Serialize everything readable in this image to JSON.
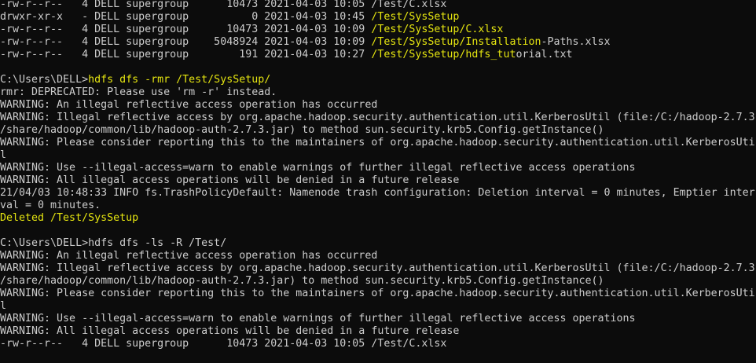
{
  "colors": {
    "background": "#0c0c0c",
    "text": "#cccccc",
    "highlight": "#e5e510"
  },
  "lines": [
    [
      {
        "t": "-rw-r--r--   4 DELL supergroup      10473 2021-04-03 10:05 ",
        "c": "w"
      },
      {
        "t": "/Test/C.xlsx",
        "c": "w"
      }
    ],
    [
      {
        "t": "drwxr-xr-x   - DELL supergroup          0 2021-04-03 10:45 ",
        "c": "w"
      },
      {
        "t": "/Test/SysSetup",
        "c": "y"
      }
    ],
    [
      {
        "t": "-rw-r--r--   4 DELL supergroup      10473 2021-04-03 10:09 ",
        "c": "w"
      },
      {
        "t": "/Test/SysSetup/C.xlsx",
        "c": "y"
      }
    ],
    [
      {
        "t": "-rw-r--r--   4 DELL supergroup    5048924 2021-04-03 10:09 ",
        "c": "w"
      },
      {
        "t": "/Test/SysSetup/Installation",
        "c": "y"
      },
      {
        "t": "-Paths.xlsx",
        "c": "w"
      }
    ],
    [
      {
        "t": "-rw-r--r--   4 DELL supergroup        191 2021-04-03 10:27 ",
        "c": "w"
      },
      {
        "t": "/Test/SysSetup/hdfs_tut",
        "c": "y"
      },
      {
        "t": "orial.txt",
        "c": "w"
      }
    ],
    [
      {
        "t": "",
        "c": "w"
      }
    ],
    [
      {
        "t": "C:\\Users\\DELL>",
        "c": "w"
      },
      {
        "t": "hdfs dfs -rmr /Test/SysSetup/",
        "c": "y"
      }
    ],
    [
      {
        "t": "rmr: DEPRECATED: Please use 'rm -r' instead.",
        "c": "w"
      }
    ],
    [
      {
        "t": "WARNING: An illegal reflective access operation has occurred",
        "c": "w"
      }
    ],
    [
      {
        "t": "WARNING: Illegal reflective access by org.apache.hadoop.security.authentication.util.KerberosUtil (file:/C:/hadoop-2.7.3",
        "c": "w"
      }
    ],
    [
      {
        "t": "/share/hadoop/common/lib/hadoop-auth-2.7.3.jar) to method sun.security.krb5.Config.getInstance()",
        "c": "w"
      }
    ],
    [
      {
        "t": "WARNING: Please consider reporting this to the maintainers of org.apache.hadoop.security.authentication.util.KerberosUti",
        "c": "w"
      }
    ],
    [
      {
        "t": "l",
        "c": "w"
      }
    ],
    [
      {
        "t": "WARNING: Use --illegal-access=warn to enable warnings of further illegal reflective access operations",
        "c": "w"
      }
    ],
    [
      {
        "t": "WARNING: All illegal access operations will be denied in a future release",
        "c": "w"
      }
    ],
    [
      {
        "t": "21/04/03 10:48:33 INFO fs.TrashPolicyDefault: Namenode trash configuration: Deletion interval = 0 minutes, Emptier inter",
        "c": "w"
      }
    ],
    [
      {
        "t": "val = 0 minutes.",
        "c": "w"
      }
    ],
    [
      {
        "t": "Deleted /Test/SysSetup",
        "c": "y"
      }
    ],
    [
      {
        "t": "",
        "c": "w"
      }
    ],
    [
      {
        "t": "C:\\Users\\DELL>hdfs dfs -ls -R /Test/",
        "c": "w"
      }
    ],
    [
      {
        "t": "WARNING: An illegal reflective access operation has occurred",
        "c": "w"
      }
    ],
    [
      {
        "t": "WARNING: Illegal reflective access by org.apache.hadoop.security.authentication.util.KerberosUtil (file:/C:/hadoop-2.7.3",
        "c": "w"
      }
    ],
    [
      {
        "t": "/share/hadoop/common/lib/hadoop-auth-2.7.3.jar) to method sun.security.krb5.Config.getInstance()",
        "c": "w"
      }
    ],
    [
      {
        "t": "WARNING: Please consider reporting this to the maintainers of org.apache.hadoop.security.authentication.util.KerberosUti",
        "c": "w"
      }
    ],
    [
      {
        "t": "l",
        "c": "w"
      }
    ],
    [
      {
        "t": "WARNING: Use --illegal-access=warn to enable warnings of further illegal reflective access operations",
        "c": "w"
      }
    ],
    [
      {
        "t": "WARNING: All illegal access operations will be denied in a future release",
        "c": "w"
      }
    ],
    [
      {
        "t": "-rw-r--r--   4 DELL supergroup      10473 2021-04-03 10:05 /Test/C.xlsx",
        "c": "w"
      }
    ]
  ]
}
